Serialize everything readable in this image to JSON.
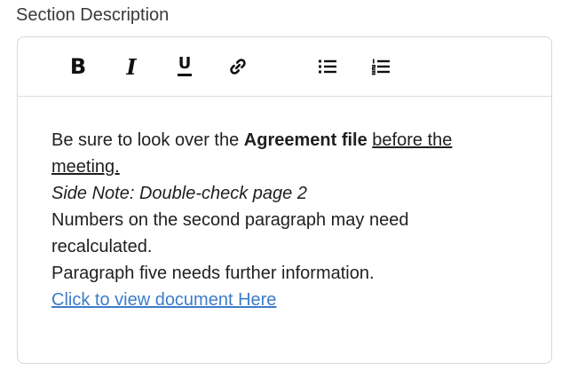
{
  "section": {
    "label": "Section Description"
  },
  "toolbar": {
    "bold_label": "B",
    "italic_label": "I",
    "underline_label": "U",
    "link_icon": "link-icon",
    "bullet_list_icon": "bulleted-list-icon",
    "numbered_list_icon": "numbered-list-icon"
  },
  "content": {
    "line1_prefix": "Be sure to look over the ",
    "line1_bold": "Agreement file",
    "line1_space": " ",
    "line1_underlined": "before the meeting.",
    "side_note": "Side Note: Double-check page 2",
    "numbers_note": "Numbers on the second paragraph may need recalculated.",
    "paragraph_five_note": "Paragraph five needs further information.",
    "link_text": "Click to view document Here"
  },
  "colors": {
    "link": "#3d7cc9",
    "border": "#d8d8d8",
    "text": "#1f1f1f"
  }
}
